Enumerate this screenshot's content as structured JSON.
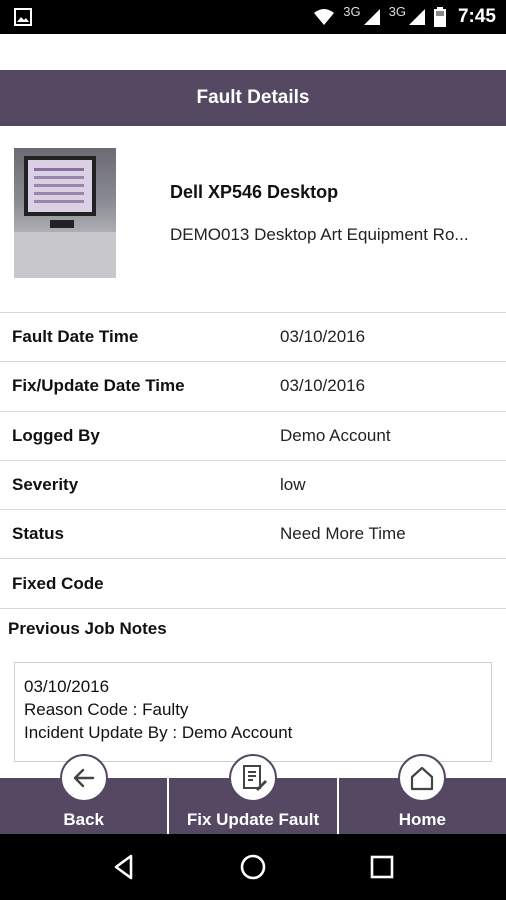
{
  "status_bar": {
    "network_1": "3G",
    "network_2": "3G",
    "time": "7:45"
  },
  "header": {
    "title": "Fault Details"
  },
  "product": {
    "name": "Dell XP546 Desktop",
    "description": "DEMO013 Desktop Art Equipment Ro..."
  },
  "details": [
    {
      "label": "Fault Date Time",
      "value": "03/10/2016"
    },
    {
      "label": "Fix/Update Date Time",
      "value": "03/10/2016"
    },
    {
      "label": "Logged By",
      "value": "Demo Account"
    },
    {
      "label": "Severity",
      "value": "low"
    },
    {
      "label": "Status",
      "value": "Need More Time"
    },
    {
      "label": "Fixed Code",
      "value": ""
    }
  ],
  "notes": {
    "title": "Previous Job Notes",
    "lines": [
      "03/10/2016",
      "Reason Code : Faulty",
      "Incident Update By : Demo Account"
    ]
  },
  "actions": {
    "back_label": "Back",
    "fix_label": "Fix Update Fault",
    "home_label": "Home"
  },
  "colors": {
    "primary": "#544863",
    "status_bar": "#000000"
  }
}
